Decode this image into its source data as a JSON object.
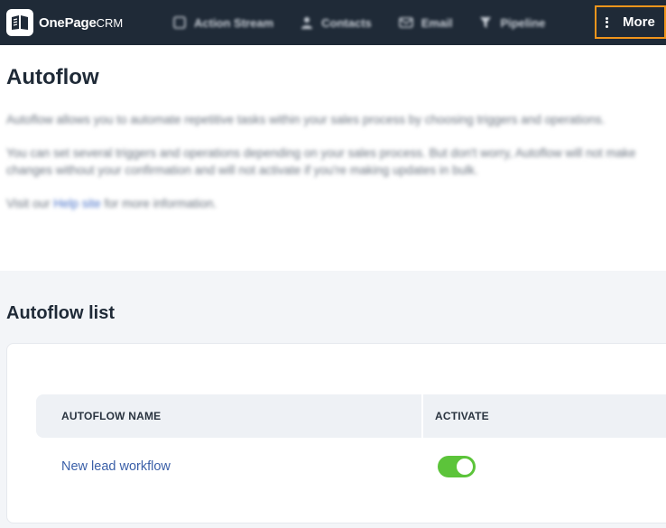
{
  "brand": {
    "name": "OnePage",
    "suffix": "CRM"
  },
  "nav": {
    "items": [
      {
        "label": "Action Stream",
        "icon": "action-stream-icon"
      },
      {
        "label": "Contacts",
        "icon": "person-icon"
      },
      {
        "label": "Email",
        "icon": "email-icon"
      },
      {
        "label": "Pipeline",
        "icon": "funnel-icon"
      }
    ],
    "more_label": "More"
  },
  "page": {
    "title": "Autoflow",
    "intro_1": "Autoflow allows you to automate repetitive tasks within your sales process by choosing triggers and operations.",
    "intro_2a": "You can set several triggers and operations depending on your sales process. But don't worry, Autoflow will not make",
    "intro_2b": "changes without your confirmation and will not activate if you're making updates in bulk.",
    "intro_3_prefix": "Visit our ",
    "intro_3_link": "Help site",
    "intro_3_suffix": " for more information."
  },
  "autoflow_list": {
    "title": "Autoflow list",
    "columns": {
      "name": "AUTOFLOW NAME",
      "activate": "ACTIVATE"
    },
    "rows": [
      {
        "name": "New lead workflow",
        "active": true
      }
    ]
  },
  "colors": {
    "topbar": "#1f2a37",
    "highlight": "#f0951c",
    "toggle_on": "#5cc43a",
    "link": "#3a5fa8"
  }
}
